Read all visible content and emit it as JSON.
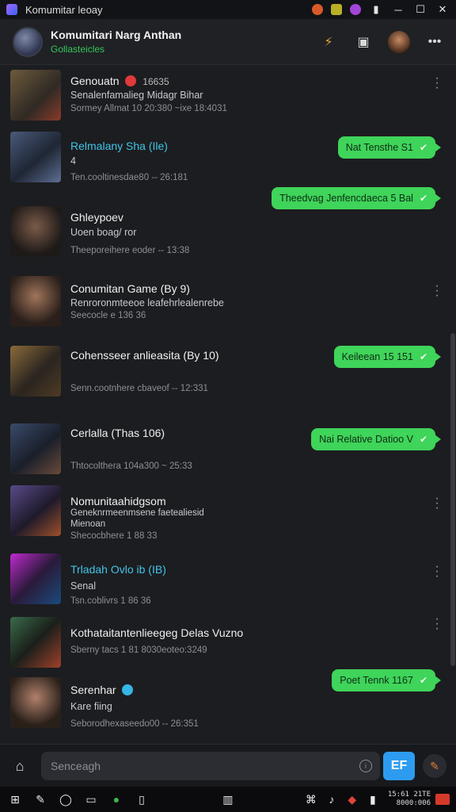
{
  "window": {
    "title": "Komumitar leoay"
  },
  "header": {
    "name": "Komumitari Narg Anthan",
    "status": "Gollasteicles"
  },
  "rows": [
    {
      "name": "Genouatn",
      "name_suffix": "16635",
      "sub": "Senalenfamalieg Midagr Bihar",
      "meta": "Sormey Allmat 10 20:380 ~ixe 18:4031"
    },
    {
      "name": "Relmalany Sha (Ile)",
      "sub": "4",
      "meta": "Ten.cooltinesdae80 -- 26:181",
      "bubble": "Nat Tensthe S1"
    },
    {
      "name": "Ghleypoev",
      "sub": "Uoen boag/ ror",
      "meta": "Theeporeihere eoder -- 13:38",
      "bubble": "Theedvag Jenfencdaeca 5 Bal"
    },
    {
      "name": "Conumitan Game (By 9)",
      "sub": "Renroronmteeoe leafehrlealenrebe",
      "meta": "Seecocle e 136 36"
    },
    {
      "name": "Cohensseer anlieasita (By 10)",
      "sub": "",
      "meta": "Senn.cootnhere cbaveof -- 12:331",
      "bubble": "Keileean 15 151"
    },
    {
      "name": "Cerlalla (Thas 106)",
      "sub": "",
      "meta": "Thtocolthera 104a300 ~ 25:33",
      "bubble": "Nai Relative Datioo V"
    },
    {
      "name": "Nomunitaahidgsom",
      "sub": "Geneknrmeenmsene faetealiesid",
      "sub2": "Mienoan",
      "meta": "Shecocbhere 1 88 33"
    },
    {
      "name": "Trladah Ovlo ib (IB)",
      "sub": "Senal",
      "meta": "Tsn.coblivrs 1 86 36"
    },
    {
      "name": "Kothataitantenlieegeg Delas Vuzno",
      "sub": "",
      "meta": "Sberny tacs 1 81 8030eoteo:3249"
    },
    {
      "name": "Serenhar",
      "sub": "Kare fiing",
      "meta": "Seborodhexaseedo00 -- 26:351",
      "bubble": "Poet Tennk 1167"
    }
  ],
  "composer": {
    "placeholder": "Senceagh",
    "send_label": "EF"
  },
  "taskbar": {
    "clock_time": "15:61 21TE",
    "clock_date": "8000:006"
  },
  "colors": {
    "bubble": "#3fd45a",
    "status_online": "#34c759",
    "send": "#2d9cf0"
  }
}
